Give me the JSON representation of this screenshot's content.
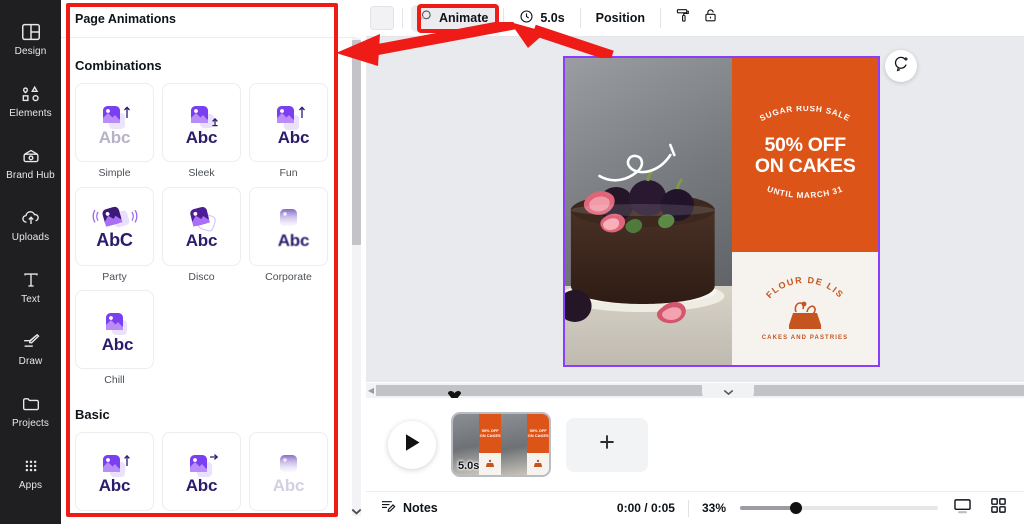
{
  "rail": {
    "items": [
      {
        "label": "Design",
        "icon": "design-icon"
      },
      {
        "label": "Elements",
        "icon": "elements-icon"
      },
      {
        "label": "Brand Hub",
        "icon": "brand-hub-icon"
      },
      {
        "label": "Uploads",
        "icon": "uploads-icon"
      },
      {
        "label": "Text",
        "icon": "text-icon"
      },
      {
        "label": "Draw",
        "icon": "draw-icon"
      },
      {
        "label": "Projects",
        "icon": "projects-icon"
      },
      {
        "label": "Apps",
        "icon": "apps-icon"
      }
    ]
  },
  "panel": {
    "title": "Page Animations",
    "sections": [
      {
        "title": "Combinations",
        "items": [
          {
            "label": "Simple"
          },
          {
            "label": "Sleek"
          },
          {
            "label": "Fun"
          },
          {
            "label": "Party"
          },
          {
            "label": "Disco"
          },
          {
            "label": "Corporate"
          },
          {
            "label": "Chill"
          }
        ]
      },
      {
        "title": "Basic",
        "items": [
          {
            "label": ""
          },
          {
            "label": ""
          },
          {
            "label": ""
          }
        ]
      }
    ],
    "tile_text": "Abc",
    "tile_text_party": "AbC"
  },
  "toolbar": {
    "color_swatch": "#f2f2f4",
    "animate_label": "Animate",
    "animate_icon": "animate-icon",
    "duration_label": "5.0s",
    "duration_icon": "clock-icon",
    "position_label": "Position",
    "transparency_icon": "paint-roller-icon",
    "lock_icon": "lock-icon"
  },
  "canvas": {
    "comment_icon": "add-comment-icon",
    "design": {
      "headline_small_top": "SUGAR RUSH SALE",
      "headline_line1": "50% OFF",
      "headline_line2": "ON CAKES",
      "headline_small_bottom": "UNTIL MARCH 31",
      "logo_name": "FLOUR DE LIS",
      "logo_tagline": "CAKES AND PASTRIES",
      "accent_color": "#dd5418",
      "selection_color": "#8b3dff"
    }
  },
  "strip": {
    "play_icon": "play-icon",
    "page_duration": "5.0s",
    "add_page_icon": "plus-icon",
    "thumb_text_line1": "50% OFF",
    "thumb_text_line2": "ON CAKES"
  },
  "bottom": {
    "notes_label": "Notes",
    "notes_icon": "notes-icon",
    "time_label": "0:00 / 0:05",
    "zoom_label": "33%",
    "presenter_icon": "presenter-view-icon",
    "grid_icon": "grid-view-icon"
  },
  "annotations": {
    "highlight_color": "#ee1b16"
  }
}
